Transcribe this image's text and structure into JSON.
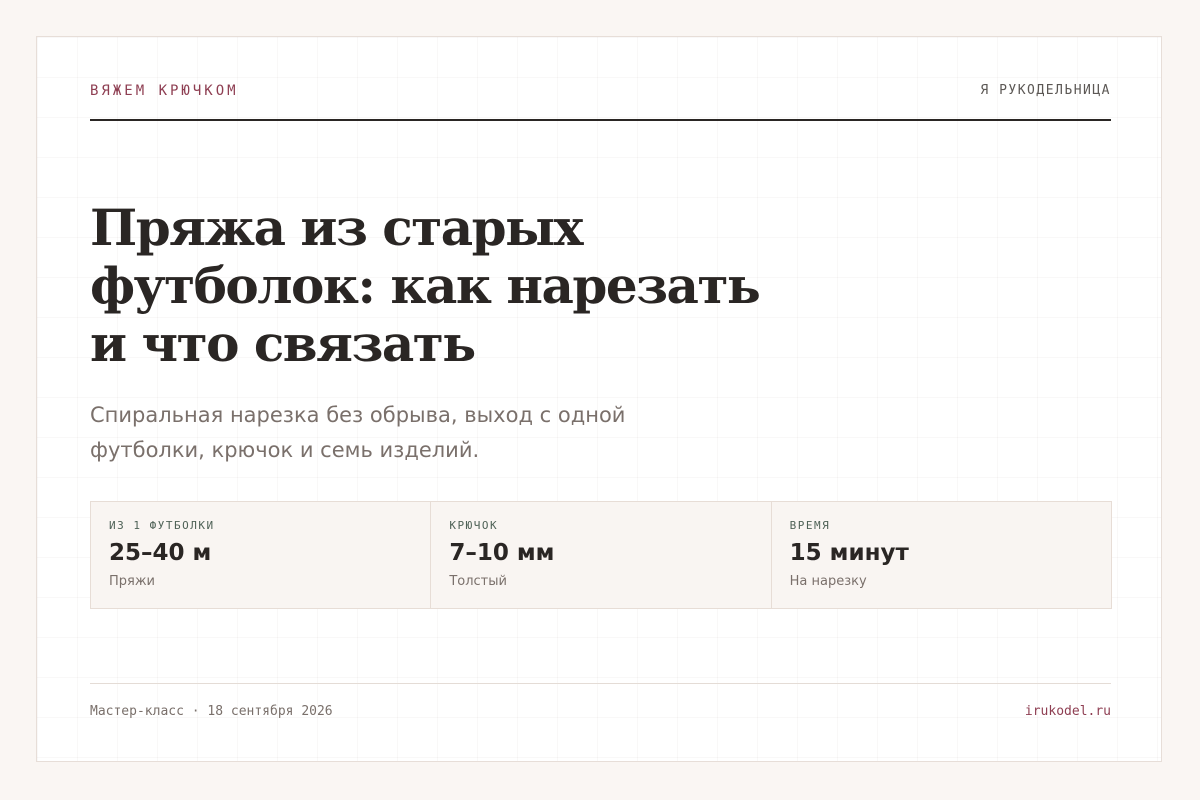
{
  "header": {
    "brand": "ВЯЖЕМ КРЮЧКОМ",
    "site_tag": "Я РУКОДЕЛЬНИЦА"
  },
  "article": {
    "title": "Пряжа из старых футболок: как нарезать и что связать",
    "subtitle": "Спиральная нарезка без обрыва, выход с одной футболки, крючок и семь изделий."
  },
  "stats": [
    {
      "label": "ИЗ 1 ФУТБОЛКИ",
      "value": "25–40 м",
      "note": "Пряжи"
    },
    {
      "label": "КРЮЧОК",
      "value": "7–10 мм",
      "note": "Толстый"
    },
    {
      "label": "ВРЕМЯ",
      "value": "15 минут",
      "note": "На нарезку"
    }
  ],
  "footer": {
    "meta": "Мастер-класс · 18 сентября 2026",
    "site": "irukodel.ru"
  },
  "colors": {
    "accent": "#8e3e52",
    "label_green": "#4f6257",
    "text_dark": "#2a2624",
    "text_muted": "#7a706b",
    "page_background": "#faf6f3"
  }
}
